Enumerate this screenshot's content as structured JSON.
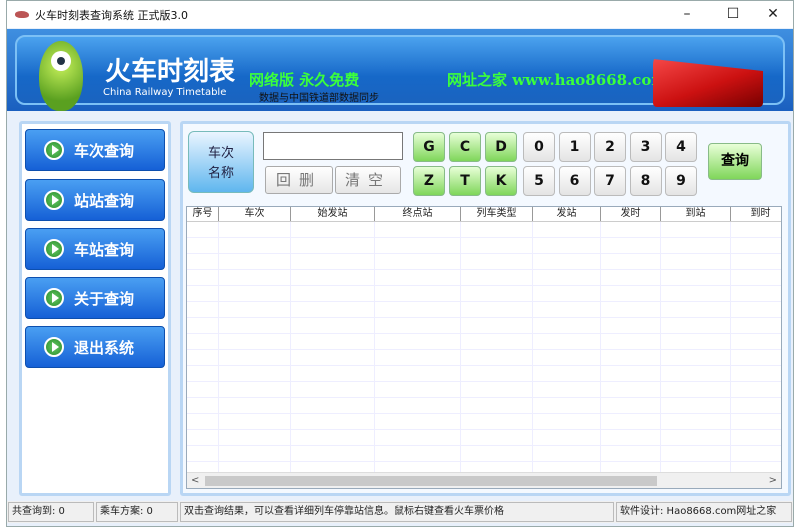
{
  "window": {
    "title": "火车时刻表查询系统  正式版3.0",
    "minimize": "–",
    "maximize": "☐",
    "close": "✕"
  },
  "banner": {
    "title": "火车时刻表",
    "subtitle": "China Railway Timetable",
    "slogan": "网络版  永久免费",
    "site": "网址之家  www.hao8668.com",
    "sync": "数据与中国铁道部数据同步"
  },
  "sidebar": {
    "items": [
      {
        "label": "车次查询"
      },
      {
        "label": "站站查询"
      },
      {
        "label": "车站查询"
      },
      {
        "label": "关于查询"
      },
      {
        "label": "退出系统"
      }
    ]
  },
  "search": {
    "mode_label_1": "车次",
    "mode_label_2": "名称",
    "input_value": "",
    "backspace": "回删",
    "clear": "清空",
    "query": "查询",
    "letter_keys": [
      "G",
      "C",
      "D",
      "Z",
      "T",
      "K"
    ],
    "digit_keys": [
      "0",
      "1",
      "2",
      "3",
      "4",
      "5",
      "6",
      "7",
      "8",
      "9"
    ]
  },
  "table": {
    "columns": [
      "序号",
      "车次",
      "始发站",
      "终点站",
      "列车类型",
      "发站",
      "发时",
      "到站",
      "到时"
    ],
    "rows": []
  },
  "status": {
    "total": "共查询到: 0",
    "plans": "乘车方案: 0",
    "hint": "双击查询结果，可以查看详细列车停靠站信息。鼠标右键查看火车票价格",
    "credit": "软件设计: Hao8668.com网址之家"
  }
}
